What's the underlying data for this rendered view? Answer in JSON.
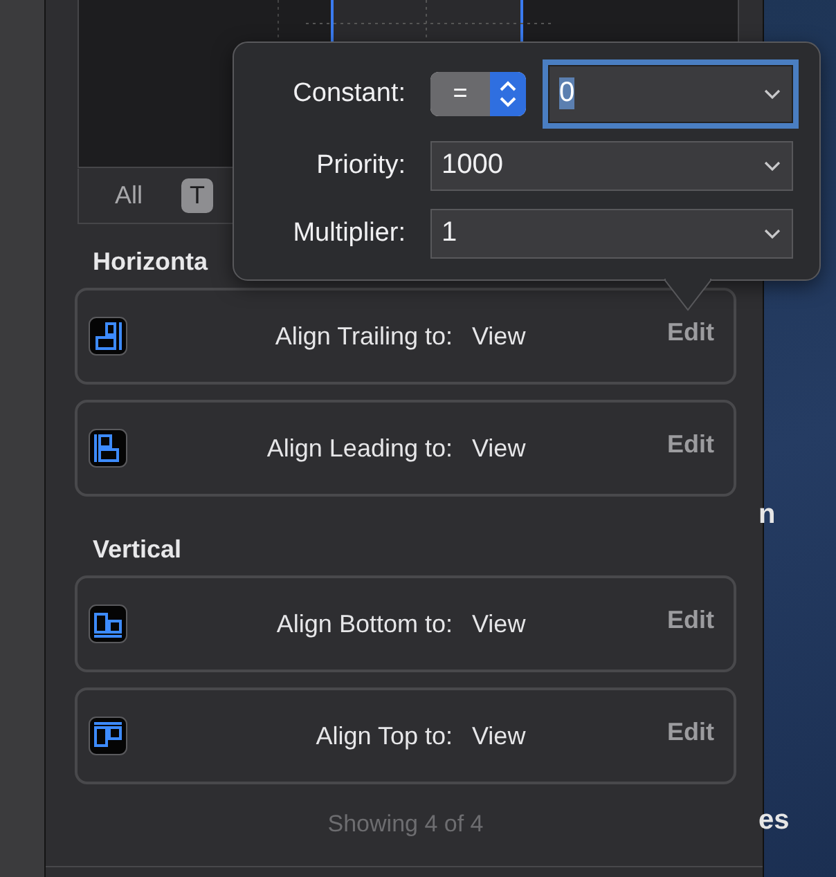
{
  "filter_tabs": [
    {
      "label": "All",
      "selected": false
    },
    {
      "label": "T",
      "selected": true
    }
  ],
  "sections": [
    {
      "title": "Horizonta",
      "constraints": [
        {
          "kind": "trailing",
          "label": "Align Trailing to:",
          "target": "View",
          "action": "Edit"
        },
        {
          "kind": "leading",
          "label": "Align Leading to:",
          "target": "View",
          "action": "Edit"
        }
      ]
    },
    {
      "title": "Vertical",
      "constraints": [
        {
          "kind": "bottom",
          "label": "Align Bottom to:",
          "target": "View",
          "action": "Edit"
        },
        {
          "kind": "top",
          "label": "Align Top to:",
          "target": "View",
          "action": "Edit"
        }
      ]
    }
  ],
  "footer": "Showing 4 of 4",
  "desktop_texts": [
    "n",
    "es"
  ],
  "popover": {
    "rows": [
      {
        "kind": "relation",
        "label": "Constant:",
        "relation": "=",
        "value": "0"
      },
      {
        "kind": "combo",
        "label": "Priority:",
        "value": "1000"
      },
      {
        "kind": "combo",
        "label": "Multiplier:",
        "value": "1"
      }
    ]
  }
}
